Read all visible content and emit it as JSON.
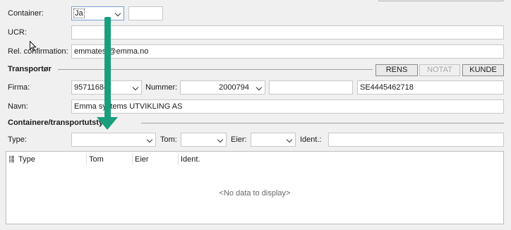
{
  "container": {
    "label": "Container:",
    "value": "Ja",
    "extra": ""
  },
  "ucr": {
    "label": "UCR:",
    "value": ""
  },
  "rel_confirmation": {
    "label": "Rel. confirmation:",
    "value": "emmatest@emma.no"
  },
  "transportor": {
    "title": "Transportør",
    "buttons": {
      "rens": "RENS",
      "notat": "NOTAT",
      "kunde": "KUNDE"
    },
    "firma_label": "Firma:",
    "firma_value": "95711684",
    "nummer_label": "Nummer:",
    "nummer_value": "2000794",
    "blank_value": "",
    "org_value": "SE4445462718",
    "navn_label": "Navn:",
    "navn_value": "Emma systems UTVIKLING AS"
  },
  "containere": {
    "title": "Containere/transportutstyr",
    "type_label": "Type:",
    "tom_label": "Tom:",
    "eier_label": "Eier:",
    "ident_label": "Ident.:",
    "type_value": "",
    "tom_value": "",
    "eier_value": "",
    "ident_value": ""
  },
  "grid": {
    "columns": [
      "Type",
      "Tom",
      "Eier",
      "Ident."
    ],
    "empty_text": "<No data to display>"
  },
  "colors": {
    "arrow": "#1a9e7c",
    "background": "#f0f0f0"
  },
  "icons": {
    "column_chooser": "column-chooser-icon",
    "cursor": "mouse-pointer-icon",
    "arrow": "annotation-arrow-icon"
  }
}
